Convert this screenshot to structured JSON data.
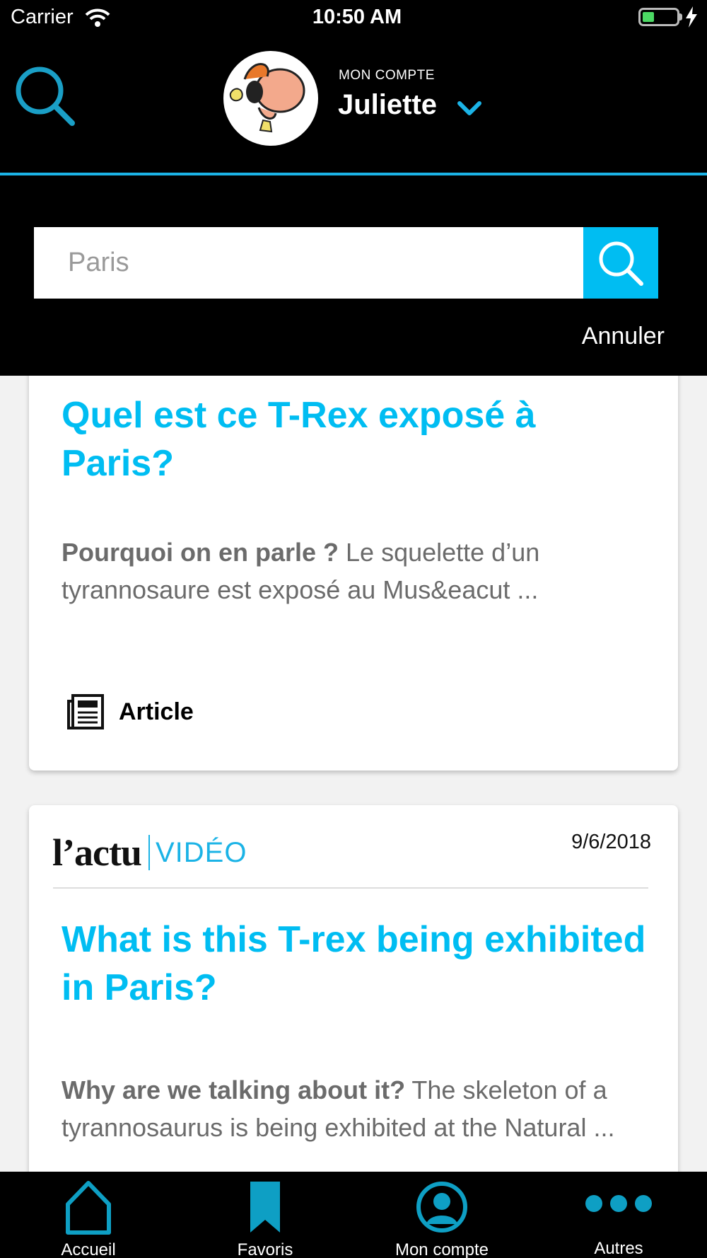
{
  "status_bar": {
    "carrier": "Carrier",
    "time": "10:50 AM"
  },
  "header": {
    "account_kicker": "MON COMPTE",
    "account_name": "Juliette"
  },
  "search": {
    "placeholder": "Paris",
    "cancel_label": "Annuler"
  },
  "results": [
    {
      "title": "Quel est ce T-Rex exposé à Paris?",
      "excerpt_bold": "Pourquoi on en parle ?",
      "excerpt_text": " Le squelette d’un tyrannosaure est exposé au Mus&eacut ...",
      "type_label": "Article"
    },
    {
      "brand_name": "l’actu",
      "brand_section": "VIDÉO",
      "date": "9/6/2018",
      "title": "What is this T-rex being exhibited in Paris?",
      "excerpt_bold": "Why are we talking about it?",
      "excerpt_text": " The skeleton of a tyrannosaurus is being exhibited at the Natural ..."
    }
  ],
  "tab_bar": {
    "items": [
      {
        "label": "Accueil",
        "icon": "home-icon"
      },
      {
        "label": "Favoris",
        "icon": "bookmark-icon"
      },
      {
        "label": "Mon compte",
        "icon": "user-icon"
      },
      {
        "label": "Autres",
        "icon": "more-icon"
      }
    ]
  },
  "colors": {
    "accent": "#00bdf2",
    "header_line": "#1bb3e6",
    "tab_icon": "#0e9fc4"
  }
}
